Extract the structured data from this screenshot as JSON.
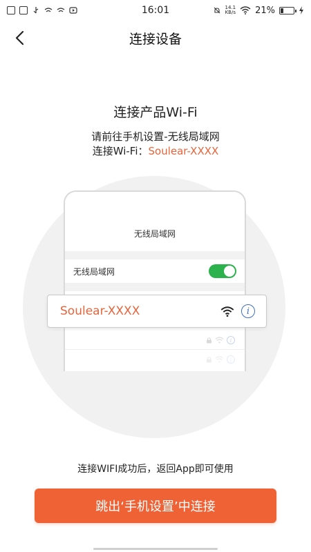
{
  "status_bar": {
    "time": "16:01",
    "net_speed_value": "14.1",
    "net_speed_unit": "KB/s",
    "battery_percent": "21%",
    "battery_level": 0.21,
    "left_icons": [
      "sim-icon",
      "nfc-icon",
      "usb-icon",
      "telecom-icon",
      "telecom-icon",
      "video-icon"
    ],
    "right_icons": [
      "mute-icon",
      "wifi-icon",
      "battery-icon",
      "charging-icon"
    ]
  },
  "header": {
    "title": "连接设备",
    "back_icon": "chevron-left-icon"
  },
  "intro": {
    "title": "连接产品Wi-Fi",
    "line1": "请前往手机设置-无线局域网",
    "line2_prefix": "连接Wi-Fi：",
    "ssid": "Soulear-XXXX"
  },
  "illustration": {
    "phone_header": "无线局域网",
    "wifi_row_label": "无线局域网",
    "wifi_toggle_on": true,
    "highlight_network": "Soulear-XXXX",
    "info_glyph": "i"
  },
  "bottom": {
    "hint": "连接WIFI成功后，返回App即可使用",
    "button_label": "跳出‘手机设置’中连接"
  },
  "colors": {
    "accent": "#ee6236",
    "ssid": "#e8643a",
    "toggle": "#2bb24c",
    "info": "#3d6fc4"
  }
}
